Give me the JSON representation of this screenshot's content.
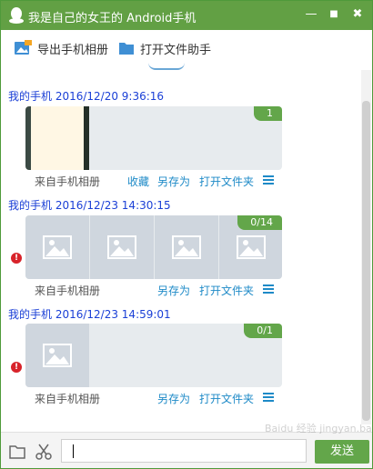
{
  "window": {
    "title": "我是自己的女王的 Android手机",
    "minimize_glyph": "—",
    "maximize_glyph": "■",
    "close_glyph": "✖"
  },
  "toolbar": {
    "export_label": "导出手机相册",
    "assistant_label": "打开文件助手"
  },
  "messages": [
    {
      "sender_time": "我的手机 2016/12/20 9:36:16",
      "badge": "1",
      "source": "来自手机相册",
      "actions": [
        "收藏",
        "另存为",
        "打开文件夹"
      ]
    },
    {
      "sender_time": "我的手机 2016/12/23 14:30:15",
      "badge": "0/14",
      "source": "来自手机相册",
      "actions": [
        "另存为",
        "打开文件夹"
      ]
    },
    {
      "sender_time": "我的手机 2016/12/23 14:59:01",
      "badge": "0/1",
      "source": "来自手机相册",
      "actions": [
        "另存为",
        "打开文件夹"
      ]
    }
  ],
  "bottom": {
    "send_label": "发送",
    "input_value": ""
  },
  "watermark": "Baidu 经验 jingyan.baidu.com",
  "colors": {
    "accent": "#62a044",
    "link": "#1e8ac7",
    "sender": "#1a3fd6",
    "error": "#d8232a"
  }
}
